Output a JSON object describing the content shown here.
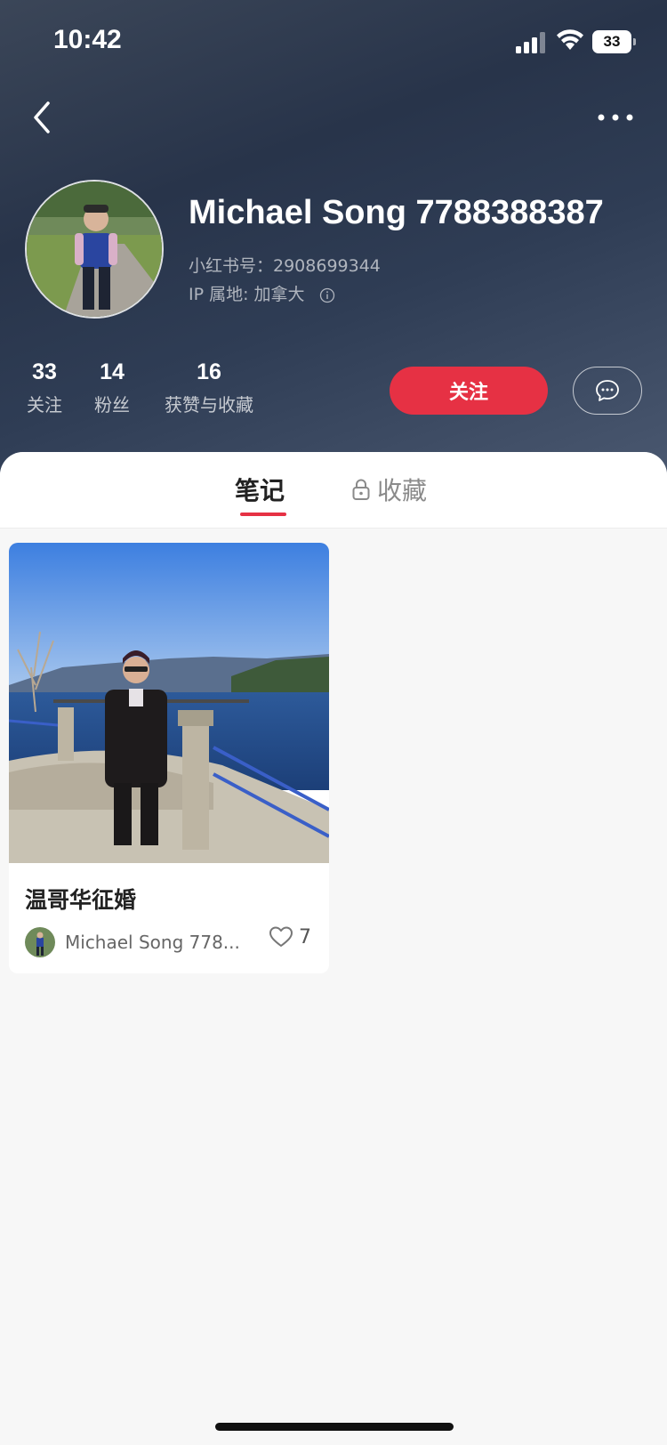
{
  "status_bar": {
    "time": "10:42",
    "battery": "33"
  },
  "profile": {
    "name": "Michael Song 7788388387",
    "id_label": "小红书号：2908699344",
    "ip_label": "IP 属地: 加拿大"
  },
  "stats": [
    {
      "value": "33",
      "label": "关注"
    },
    {
      "value": "14",
      "label": "粉丝"
    },
    {
      "value": "16",
      "label": "获赞与收藏"
    }
  ],
  "actions": {
    "follow_label": "关注"
  },
  "tabs": [
    {
      "label": "笔记",
      "active": true
    },
    {
      "label": "收藏",
      "active": false,
      "locked": true
    }
  ],
  "notes": [
    {
      "title": "温哥华征婚",
      "author": "Michael Song 778...",
      "likes": "7"
    }
  ],
  "colors": {
    "accent": "#e63144",
    "header_bg": "#2c3850"
  },
  "icons": [
    "back-icon",
    "more-icon",
    "info-icon",
    "chat-icon",
    "lock-icon",
    "heart-icon",
    "signal-icon",
    "wifi-icon"
  ]
}
